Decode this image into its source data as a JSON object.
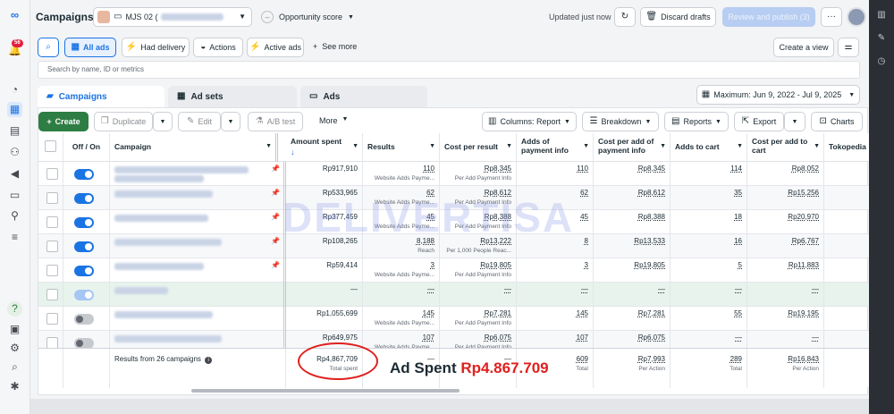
{
  "sidebar": {
    "notifications_badge": "56"
  },
  "header": {
    "title": "Campaigns",
    "account_name": "MJS 02 (",
    "opportunity_label": "Opportunity score",
    "updated_text": "Updated just now",
    "discard_label": "Discard drafts",
    "review_label": "Review and publish (3)"
  },
  "filters": {
    "all_ads": "All ads",
    "had_delivery": "Had delivery",
    "actions": "Actions",
    "active_ads": "Active ads",
    "see_more": "See more",
    "create_view": "Create a view"
  },
  "search": {
    "placeholder": "Search by name, ID or metrics"
  },
  "tabs": {
    "campaigns": "Campaigns",
    "ad_sets": "Ad sets",
    "ads": "Ads"
  },
  "date_range": "Maximum: Jun 9, 2022 - Jul 9, 2025",
  "toolbar": {
    "create": "Create",
    "duplicate": "Duplicate",
    "edit": "Edit",
    "ab_test": "A/B test",
    "more": "More",
    "columns": "Columns: Report",
    "breakdown": "Breakdown",
    "reports": "Reports",
    "export": "Export",
    "charts": "Charts"
  },
  "columns": {
    "off_on": "Off / On",
    "campaign": "Campaign",
    "amount_spent": "Amount spent",
    "results": "Results",
    "cost_per_result": "Cost per result",
    "adds_payment": "Adds of payment info",
    "cost_per_add": "Cost per add of payment info",
    "adds_cart": "Adds to cart",
    "cost_per_add_cart": "Cost per add to cart",
    "tokopedia": "Tokopedia"
  },
  "rows": [
    {
      "spent": "Rp917,910",
      "results": "110",
      "results_sub": "Website Adds Payme...",
      "cpr": "Rp8,345",
      "cpr_sub": "Per Add Payment Info",
      "adds": "110",
      "cpa": "Rp8,345",
      "cart": "114",
      "cpc": "Rp8,052"
    },
    {
      "spent": "Rp533,965",
      "results": "62",
      "results_sub": "Website Adds Payme...",
      "cpr": "Rp8,612",
      "cpr_sub": "Per Add Payment Info",
      "adds": "62",
      "cpa": "Rp8,612",
      "cart": "35",
      "cpc": "Rp15,256"
    },
    {
      "spent": "Rp377,459",
      "results": "45",
      "results_sub": "Website Adds Payme...",
      "cpr": "Rp8,388",
      "cpr_sub": "Per Add Payment Info",
      "adds": "45",
      "cpa": "Rp8,388",
      "cart": "18",
      "cpc": "Rp20,970"
    },
    {
      "spent": "Rp108,265",
      "results": "8,188",
      "results_sub": "Reach",
      "cpr": "Rp13,222",
      "cpr_sub": "Per 1,000 People Reac...",
      "adds": "8",
      "cpa": "Rp13,533",
      "cart": "16",
      "cpc": "Rp6,767"
    },
    {
      "spent": "Rp59,414",
      "results": "3",
      "results_sub": "Website Adds Payme...",
      "cpr": "Rp19,805",
      "cpr_sub": "Per Add Payment Info",
      "adds": "3",
      "cpa": "Rp19,805",
      "cart": "5",
      "cpc": "Rp11,883"
    },
    {
      "spent": "—",
      "results": "—",
      "results_sub": "",
      "cpr": "—",
      "cpr_sub": "",
      "adds": "—",
      "cpa": "—",
      "cart": "—",
      "cpc": "—"
    },
    {
      "spent": "Rp1,055,699",
      "results": "145",
      "results_sub": "Website Adds Payme...",
      "cpr": "Rp7,281",
      "cpr_sub": "Per Add Payment Info",
      "adds": "145",
      "cpa": "Rp7,281",
      "cart": "55",
      "cpc": "Rp19,195"
    },
    {
      "spent": "Rp649,975",
      "results": "107",
      "results_sub": "Website Adds Payme...",
      "cpr": "Rp6,075",
      "cpr_sub": "Per Add Payment Info",
      "adds": "107",
      "cpa": "Rp6,075",
      "cart": "—",
      "cpc": "—"
    }
  ],
  "totals": {
    "label": "Results from 26 campaigns",
    "spent": "Rp4,867,709",
    "spent_sub": "Total spent",
    "results": "—",
    "cpr": "—",
    "adds": "609",
    "adds_sub": "Total",
    "cpa": "Rp7,993",
    "cpa_sub": "Per Action",
    "cart": "289",
    "cart_sub": "Total",
    "cpc": "Rp16,843",
    "cpc_sub": "Per Action"
  },
  "watermark": "DELIVERTISA",
  "annotation": {
    "label": "Ad Spent",
    "value": "Rp4.867.709"
  },
  "colors": {
    "accent": "#1b74e4",
    "create_green": "#2e7d44",
    "annotation_red": "#e0201e"
  }
}
